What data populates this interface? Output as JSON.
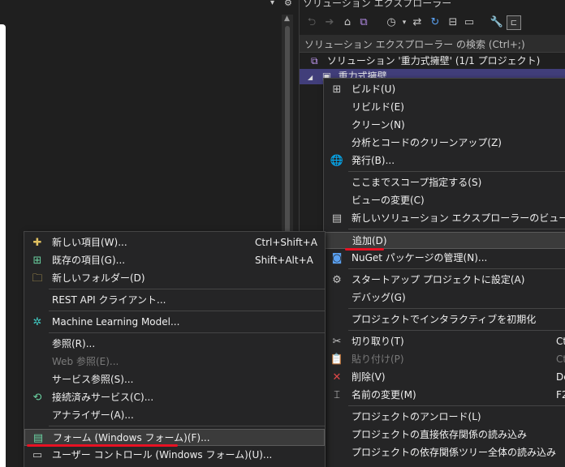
{
  "solution_explorer": {
    "title": "ソリューション エクスプローラー",
    "search_placeholder": "ソリューション エクスプローラー の検索 (Ctrl+;)",
    "solution_label": "ソリューション '重力式擁壁' (1/1 プロジェクト)",
    "project_label": "重力式擁壁"
  },
  "context_menu": {
    "items": [
      {
        "label": "ビルド(U)"
      },
      {
        "label": "リビルド(E)"
      },
      {
        "label": "クリーン(N)"
      },
      {
        "label": "分析とコードのクリーンアップ(Z)"
      },
      {
        "label": "発行(B)..."
      },
      {
        "label": "ここまでスコープ指定する(S)"
      },
      {
        "label": "ビューの変更(C)"
      },
      {
        "label": "新しいソリューション エクスプローラーのビュー(N)"
      },
      {
        "label": "追加(D)"
      },
      {
        "label": "NuGet パッケージの管理(N)..."
      },
      {
        "label": "スタートアップ プロジェクトに設定(A)"
      },
      {
        "label": "デバッグ(G)"
      },
      {
        "label": "プロジェクトでインタラクティブを初期化"
      },
      {
        "label": "切り取り(T)",
        "shortcut": "Ct"
      },
      {
        "label": "貼り付け(P)",
        "shortcut": "Ct"
      },
      {
        "label": "削除(V)",
        "shortcut": "De"
      },
      {
        "label": "名前の変更(M)",
        "shortcut": "F2"
      },
      {
        "label": "プロジェクトのアンロード(L)"
      },
      {
        "label": "プロジェクトの直接依存関係の読み込み"
      },
      {
        "label": "プロジェクトの依存関係ツリー全体の読み込み"
      }
    ]
  },
  "add_submenu": {
    "items": [
      {
        "label": "新しい項目(W)...",
        "shortcut": "Ctrl+Shift+A"
      },
      {
        "label": "既存の項目(G)...",
        "shortcut": "Shift+Alt+A"
      },
      {
        "label": "新しいフォルダー(D)"
      },
      {
        "label": "REST API クライアント..."
      },
      {
        "label": "Machine Learning Model..."
      },
      {
        "label": "参照(R)..."
      },
      {
        "label": "Web 参照(E)..."
      },
      {
        "label": "サービス参照(S)..."
      },
      {
        "label": "接続済みサービス(C)..."
      },
      {
        "label": "アナライザー(A)..."
      },
      {
        "label": "フォーム (Windows フォーム)(F)..."
      },
      {
        "label": "ユーザー コントロール (Windows フォーム)(U)..."
      }
    ]
  },
  "colors": {
    "background": "#1f1f1f",
    "menu_background": "#252526",
    "selected_row": "#413e7a",
    "highlight_underline": "#e81123"
  }
}
